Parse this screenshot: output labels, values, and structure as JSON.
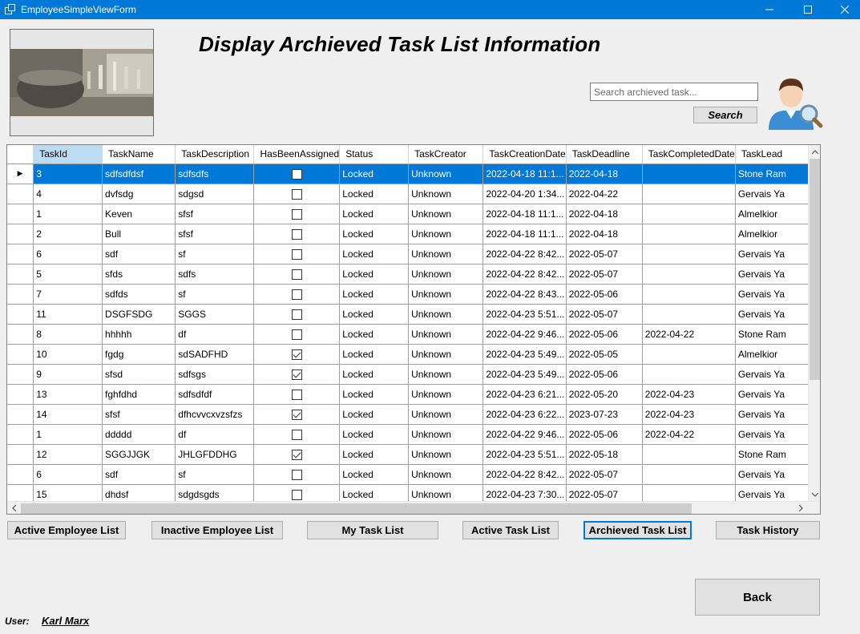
{
  "window": {
    "title": "EmployeeSimpleViewForm",
    "minimize": "—",
    "maximize": "☐",
    "close": "✕"
  },
  "header": {
    "heading": "Display Archieved Task List Information"
  },
  "search": {
    "placeholder": "Search archieved task...",
    "value": "",
    "button_label": "Search"
  },
  "grid": {
    "columns": [
      "TaskId",
      "TaskName",
      "TaskDescription",
      "HasBeenAssigned",
      "Status",
      "TaskCreator",
      "TaskCreationDate",
      "TaskDeadline",
      "TaskCompletedDate",
      "TaskLead"
    ],
    "selected_column": "TaskId",
    "current_row_marker": "▶",
    "rows": [
      {
        "id": "3",
        "name": "sdfsdfdsf",
        "desc": "sdfsdfs",
        "assigned": false,
        "status": "Locked",
        "creator": "Unknown",
        "created": "2022-04-18 11:1...",
        "deadline": "2022-04-18",
        "completed": "",
        "lead": "Stone Ram",
        "selected": true
      },
      {
        "id": "4",
        "name": "dvfsdg",
        "desc": "sdgsd",
        "assigned": false,
        "status": "Locked",
        "creator": "Unknown",
        "created": "2022-04-20 1:34...",
        "deadline": "2022-04-22",
        "completed": "",
        "lead": "Gervais Ya"
      },
      {
        "id": "1",
        "name": "Keven",
        "desc": "sfsf",
        "assigned": false,
        "status": "Locked",
        "creator": "Unknown",
        "created": "2022-04-18 11:1...",
        "deadline": "2022-04-18",
        "completed": "",
        "lead": "Almelkior"
      },
      {
        "id": "2",
        "name": "Bull",
        "desc": "sfsf",
        "assigned": false,
        "status": "Locked",
        "creator": "Unknown",
        "created": "2022-04-18 11:1...",
        "deadline": "2022-04-18",
        "completed": "",
        "lead": "Almelkior"
      },
      {
        "id": "6",
        "name": "sdf",
        "desc": "sf",
        "assigned": false,
        "status": "Locked",
        "creator": "Unknown",
        "created": "2022-04-22 8:42...",
        "deadline": "2022-05-07",
        "completed": "",
        "lead": "Gervais Ya"
      },
      {
        "id": "5",
        "name": "sfds",
        "desc": "sdfs",
        "assigned": false,
        "status": "Locked",
        "creator": "Unknown",
        "created": "2022-04-22 8:42...",
        "deadline": "2022-05-07",
        "completed": "",
        "lead": "Gervais Ya"
      },
      {
        "id": "7",
        "name": "sdfds",
        "desc": "sf",
        "assigned": false,
        "status": "Locked",
        "creator": "Unknown",
        "created": "2022-04-22 8:43...",
        "deadline": "2022-05-06",
        "completed": "",
        "lead": "Gervais Ya"
      },
      {
        "id": "11",
        "name": "DSGFSDG",
        "desc": "SGGS",
        "assigned": false,
        "status": "Locked",
        "creator": "Unknown",
        "created": "2022-04-23 5:51...",
        "deadline": "2022-05-07",
        "completed": "",
        "lead": "Gervais Ya"
      },
      {
        "id": "8",
        "name": "hhhhh",
        "desc": "df",
        "assigned": false,
        "status": "Locked",
        "creator": "Unknown",
        "created": "2022-04-22 9:46...",
        "deadline": "2022-05-06",
        "completed": "2022-04-22",
        "lead": "Stone Ram"
      },
      {
        "id": "10",
        "name": "fgdg",
        "desc": "sdSADFHD",
        "assigned": true,
        "status": "Locked",
        "creator": "Unknown",
        "created": "2022-04-23 5:49...",
        "deadline": "2022-05-05",
        "completed": "",
        "lead": "Almelkior"
      },
      {
        "id": "9",
        "name": "sfsd",
        "desc": "sdfsgs",
        "assigned": true,
        "status": "Locked",
        "creator": "Unknown",
        "created": "2022-04-23 5:49...",
        "deadline": "2022-05-06",
        "completed": "",
        "lead": "Gervais Ya"
      },
      {
        "id": "13",
        "name": "fghfdhd",
        "desc": "sdfsdfdf",
        "assigned": false,
        "status": "Locked",
        "creator": "Unknown",
        "created": "2022-04-23 6:21...",
        "deadline": "2022-05-20",
        "completed": "2022-04-23",
        "lead": "Gervais Ya"
      },
      {
        "id": "14",
        "name": "sfsf",
        "desc": "dfhcvvcxvzsfzs",
        "assigned": true,
        "status": "Locked",
        "creator": "Unknown",
        "created": "2022-04-23 6:22...",
        "deadline": "2023-07-23",
        "completed": "2022-04-23",
        "lead": "Gervais Ya"
      },
      {
        "id": "1",
        "name": "ddddd",
        "desc": "df",
        "assigned": false,
        "status": "Locked",
        "creator": "Unknown",
        "created": "2022-04-22 9:46...",
        "deadline": "2022-05-06",
        "completed": "2022-04-22",
        "lead": "Gervais Ya"
      },
      {
        "id": "12",
        "name": "SGGJJGK",
        "desc": "JHLGFDDHG",
        "assigned": true,
        "status": "Locked",
        "creator": "Unknown",
        "created": "2022-04-23 5:51...",
        "deadline": "2022-05-18",
        "completed": "",
        "lead": "Stone Ram"
      },
      {
        "id": "6",
        "name": "sdf",
        "desc": "sf",
        "assigned": false,
        "status": "Locked",
        "creator": "Unknown",
        "created": "2022-04-22 8:42...",
        "deadline": "2022-05-07",
        "completed": "",
        "lead": "Gervais Ya"
      },
      {
        "id": "15",
        "name": "dhdsf",
        "desc": "sdgdsgds",
        "assigned": false,
        "status": "Locked",
        "creator": "Unknown",
        "created": "2022-04-23 7:30...",
        "deadline": "2022-05-07",
        "completed": "",
        "lead": "Gervais Ya"
      }
    ]
  },
  "nav": {
    "active_employee": "Active Employee List",
    "inactive_employee": "Inactive Employee List",
    "my_task": "My Task List",
    "active_task": "Active Task List",
    "archieved_task": "Archieved Task List",
    "task_history": "Task History"
  },
  "back_label": "Back",
  "user": {
    "label": "User:",
    "name": "Karl Marx"
  }
}
